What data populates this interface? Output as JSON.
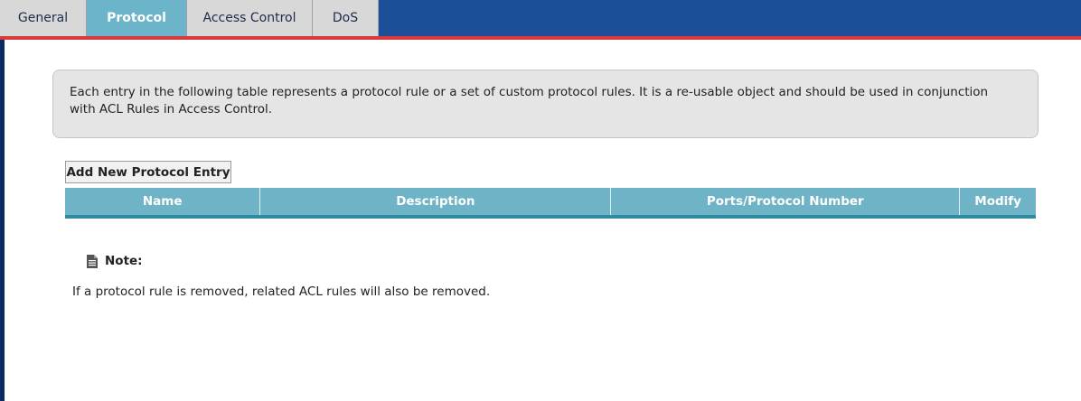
{
  "tabs": [
    {
      "label": "General",
      "active": false
    },
    {
      "label": "Protocol",
      "active": true
    },
    {
      "label": "Access Control",
      "active": false
    },
    {
      "label": "DoS",
      "active": false
    }
  ],
  "info": {
    "text": "Each entry in the following table represents a protocol rule or a set of custom protocol rules. It is a re-usable object and should be used in conjunction with ACL Rules in Access Control."
  },
  "actions": {
    "add_label": "Add New Protocol Entry"
  },
  "table": {
    "columns": [
      "Name",
      "Description",
      "Ports/Protocol Number",
      "Modify"
    ],
    "rows": []
  },
  "note": {
    "title": "Note:",
    "text": "If a protocol rule is removed, related ACL rules will also be removed.",
    "icon": "document-icon"
  },
  "colors": {
    "tabbar": "#1c4f98",
    "tabbar_border": "#d63a3a",
    "active_tab": "#6bb4c9",
    "table_header": "#6fb4c6"
  }
}
